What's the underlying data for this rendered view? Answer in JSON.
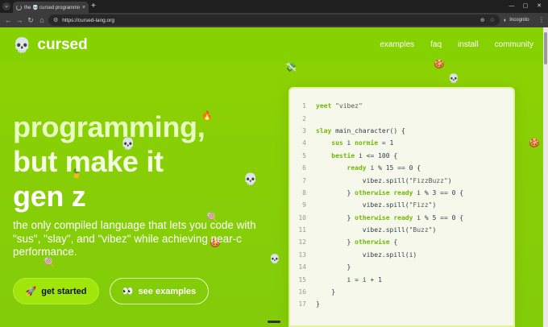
{
  "browser": {
    "tab_title": "the 💀 cursed programming lan",
    "tab_close": "×",
    "new_tab": "+",
    "menu_btn": "⌄",
    "url": "https://cursed-lang.org",
    "incognito_label": "Incognito",
    "minimize": "—",
    "maximize": "▢",
    "close": "✕",
    "menu": "⋮",
    "back": "←",
    "forward": "→",
    "reload": "↻",
    "home": "⌂"
  },
  "nav": {
    "logo_icon": "💀",
    "logo_text": "cursed",
    "links": [
      "examples",
      "faq",
      "install",
      "community"
    ]
  },
  "hero": {
    "title_lines": [
      "programming,",
      "but make it",
      "gen z"
    ],
    "subtitle": "the only compiled language that lets you code with \"sus\", \"slay\", and \"vibez\" while achieving near-c performance.",
    "primary_icon": "🚀",
    "primary_label": "get started",
    "secondary_icon": "👀",
    "secondary_label": "see examples"
  },
  "code": {
    "line_numbers": [
      "1",
      "2",
      "3",
      "4",
      "5",
      "6",
      "7",
      "8",
      "9",
      "10",
      "11",
      "12",
      "13",
      "14",
      "15",
      "16",
      "17"
    ]
  },
  "colors": {
    "page_bg": "#8fd400",
    "accent_keyword": "#6fb800",
    "card_bg": "#f7f8ec"
  },
  "decorations": {
    "skull": "💀",
    "lollipop": "🍭",
    "rocket": "🚀",
    "pineapple": "🍍",
    "fire": "🔥",
    "cash": "💸",
    "cookie": "🍪"
  }
}
